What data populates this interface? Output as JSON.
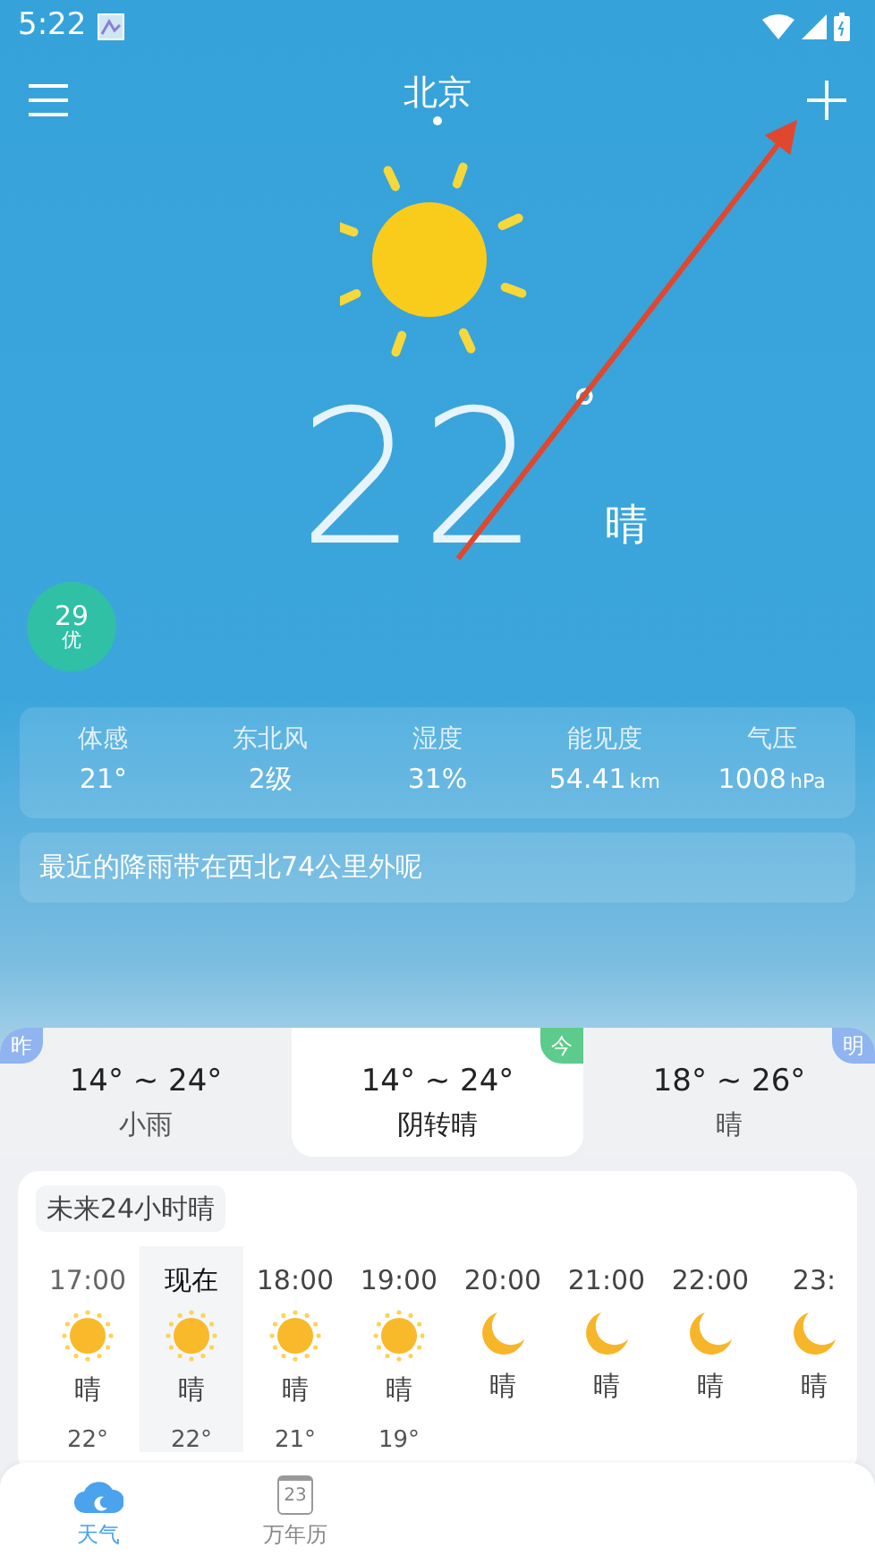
{
  "status_bar": {
    "time": "5:22"
  },
  "header": {
    "city": "北京"
  },
  "current": {
    "temperature": "22",
    "degree": "°",
    "condition": "晴"
  },
  "air_quality": {
    "value": "29",
    "label": "优"
  },
  "details": [
    {
      "label": "体感",
      "value": "21°"
    },
    {
      "label": "东北风",
      "value": "2级"
    },
    {
      "label": "湿度",
      "value": "31%"
    },
    {
      "label": "能见度",
      "value": "54.41",
      "unit": "km"
    },
    {
      "label": "气压",
      "value": "1008",
      "unit": "hPa"
    }
  ],
  "notice": "最近的降雨带在西北74公里外呢",
  "days": [
    {
      "badge": "昨",
      "color": "#8fb4ef",
      "range": "14° ~ 24°",
      "condition": "小雨",
      "selected": false
    },
    {
      "badge": "今",
      "color": "#5ccb8c",
      "range": "14° ~ 24°",
      "condition": "阴转晴",
      "selected": true
    },
    {
      "badge": "明",
      "color": "#8fb4ef",
      "range": "18° ~ 26°",
      "condition": "晴",
      "selected": false
    }
  ],
  "hourly": {
    "title": "未来24小时晴",
    "hours": [
      {
        "time": "17:00",
        "kind": "sun",
        "condition": "晴",
        "temp": "22°",
        "selected": false
      },
      {
        "time": "现在",
        "kind": "sun",
        "condition": "晴",
        "temp": "22°",
        "selected": true
      },
      {
        "time": "18:00",
        "kind": "sun",
        "condition": "晴",
        "temp": "21°",
        "selected": false
      },
      {
        "time": "19:00",
        "kind": "sun",
        "condition": "晴",
        "temp": "19°",
        "selected": false
      },
      {
        "time": "20:00",
        "kind": "moon",
        "condition": "晴",
        "selected": false
      },
      {
        "time": "21:00",
        "kind": "moon",
        "condition": "晴",
        "selected": false
      },
      {
        "time": "22:00",
        "kind": "moon",
        "condition": "晴",
        "selected": false
      },
      {
        "time": "23:",
        "kind": "moon",
        "condition": "晴",
        "selected": false
      }
    ]
  },
  "bottom_nav": [
    {
      "label": "天气",
      "kind": "cloud",
      "selected": true
    },
    {
      "label": "万年历",
      "kind": "calendar",
      "icon_text": "23",
      "selected": false
    }
  ]
}
